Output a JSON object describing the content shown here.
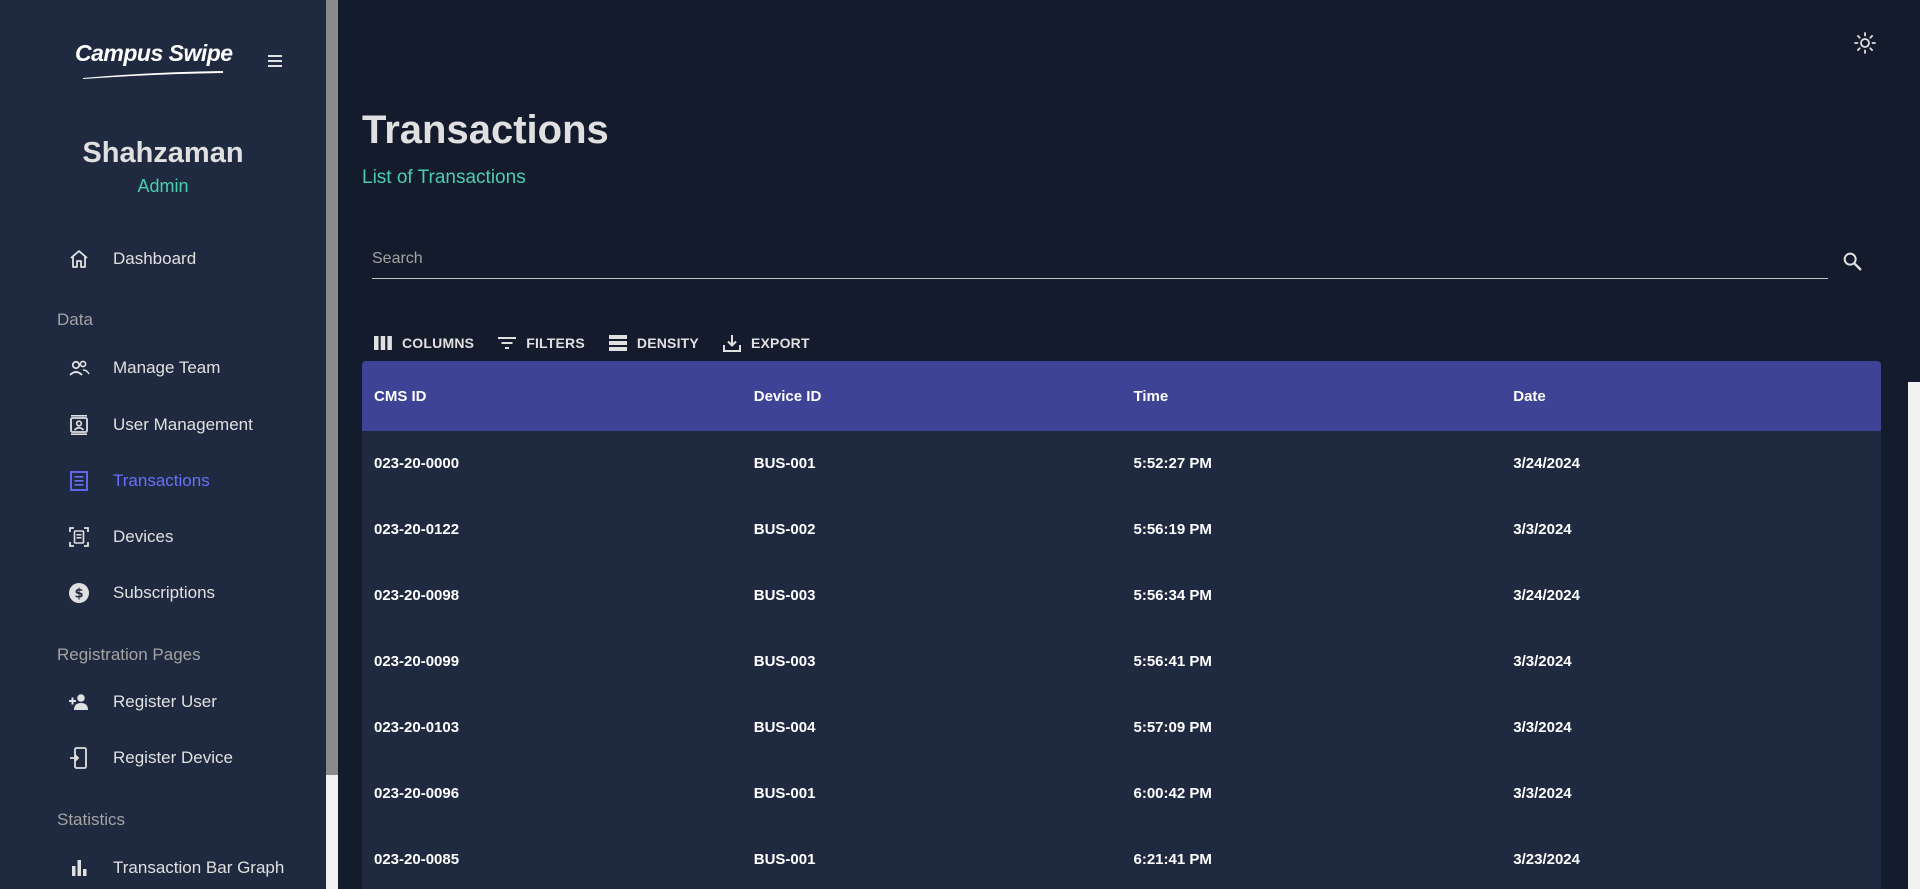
{
  "brand": {
    "logo_text_a": "Campus ",
    "logo_text_b": "Swipe"
  },
  "profile": {
    "name": "Shahzaman",
    "role": "Admin"
  },
  "sidebar": {
    "items": [
      {
        "label": "Dashboard",
        "icon": "home-icon"
      },
      {
        "label": "Manage Team",
        "icon": "people-icon"
      },
      {
        "label": "User Management",
        "icon": "contacts-icon"
      },
      {
        "label": "Transactions",
        "icon": "receipt-icon",
        "active": true
      },
      {
        "label": "Devices",
        "icon": "devices-icon"
      },
      {
        "label": "Subscriptions",
        "icon": "dollar-circle-icon"
      },
      {
        "label": "Register User",
        "icon": "person-add-icon"
      },
      {
        "label": "Register Device",
        "icon": "device-add-icon"
      },
      {
        "label": "Transaction Bar Graph",
        "icon": "bar-chart-icon"
      }
    ],
    "sections": {
      "data": "Data",
      "registration": "Registration Pages",
      "statistics": "Statistics"
    }
  },
  "main": {
    "title": "Transactions",
    "subtitle": "List of Transactions",
    "search": {
      "placeholder": "Search",
      "value": ""
    },
    "toolbar": {
      "columns": "COLUMNS",
      "filters": "FILTERS",
      "density": "DENSITY",
      "export": "EXPORT"
    }
  },
  "table": {
    "columns": [
      "CMS ID",
      "Device ID",
      "Time",
      "Date"
    ],
    "rows": [
      [
        "023-20-0000",
        "BUS-001",
        "5:52:27 PM",
        "3/24/2024"
      ],
      [
        "023-20-0122",
        "BUS-002",
        "5:56:19 PM",
        "3/3/2024"
      ],
      [
        "023-20-0098",
        "BUS-003",
        "5:56:34 PM",
        "3/24/2024"
      ],
      [
        "023-20-0099",
        "BUS-003",
        "5:56:41 PM",
        "3/3/2024"
      ],
      [
        "023-20-0103",
        "BUS-004",
        "5:57:09 PM",
        "3/3/2024"
      ],
      [
        "023-20-0096",
        "BUS-001",
        "6:00:42 PM",
        "3/3/2024"
      ],
      [
        "023-20-0085",
        "BUS-001",
        "6:21:41 PM",
        "3/23/2024"
      ]
    ]
  },
  "colors": {
    "sidebar_bg": "#1f2a40",
    "main_bg": "#141b2d",
    "accent_green": "#4cceac",
    "accent_blue": "#6870fa",
    "header_bg": "#3e4396"
  }
}
